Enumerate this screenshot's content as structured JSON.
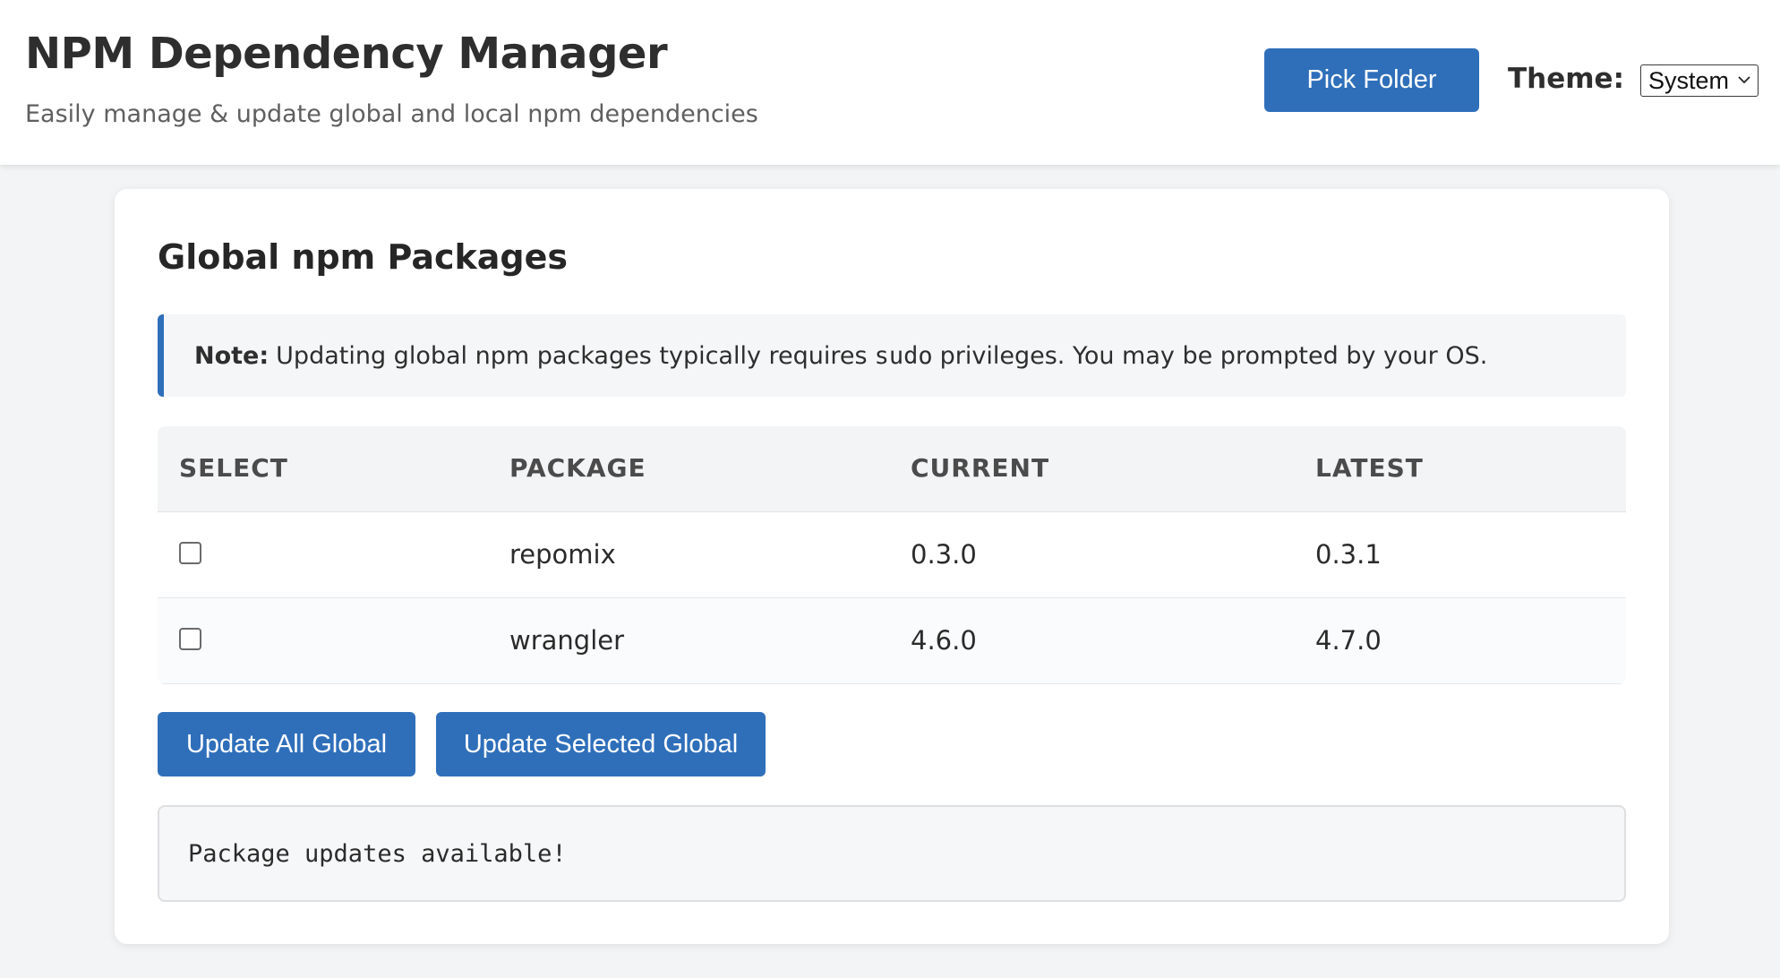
{
  "header": {
    "title": "NPM Dependency Manager",
    "subtitle": "Easily manage & update global and local npm dependencies",
    "pick_folder_label": "Pick Folder",
    "theme_label": "Theme:",
    "theme_selected": "System"
  },
  "global": {
    "title": "Global npm Packages",
    "note_strong": "Note:",
    "note_before": "Updating global npm packages typically requires",
    "note_code": "sudo",
    "note_after": "privileges. You may be prompted by your OS.",
    "columns": [
      "SELECT",
      "PACKAGE",
      "CURRENT",
      "LATEST"
    ],
    "rows": [
      {
        "package": "repomix",
        "current": "0.3.0",
        "latest": "0.3.1",
        "selected": false
      },
      {
        "package": "wrangler",
        "current": "4.6.0",
        "latest": "4.7.0",
        "selected": false
      }
    ],
    "update_all_label": "Update All Global",
    "update_selected_label": "Update Selected Global",
    "output_text": "Package updates available!"
  },
  "colors": {
    "accent": "#2f6fba",
    "background": "#f3f4f5",
    "card": "#ffffff"
  }
}
